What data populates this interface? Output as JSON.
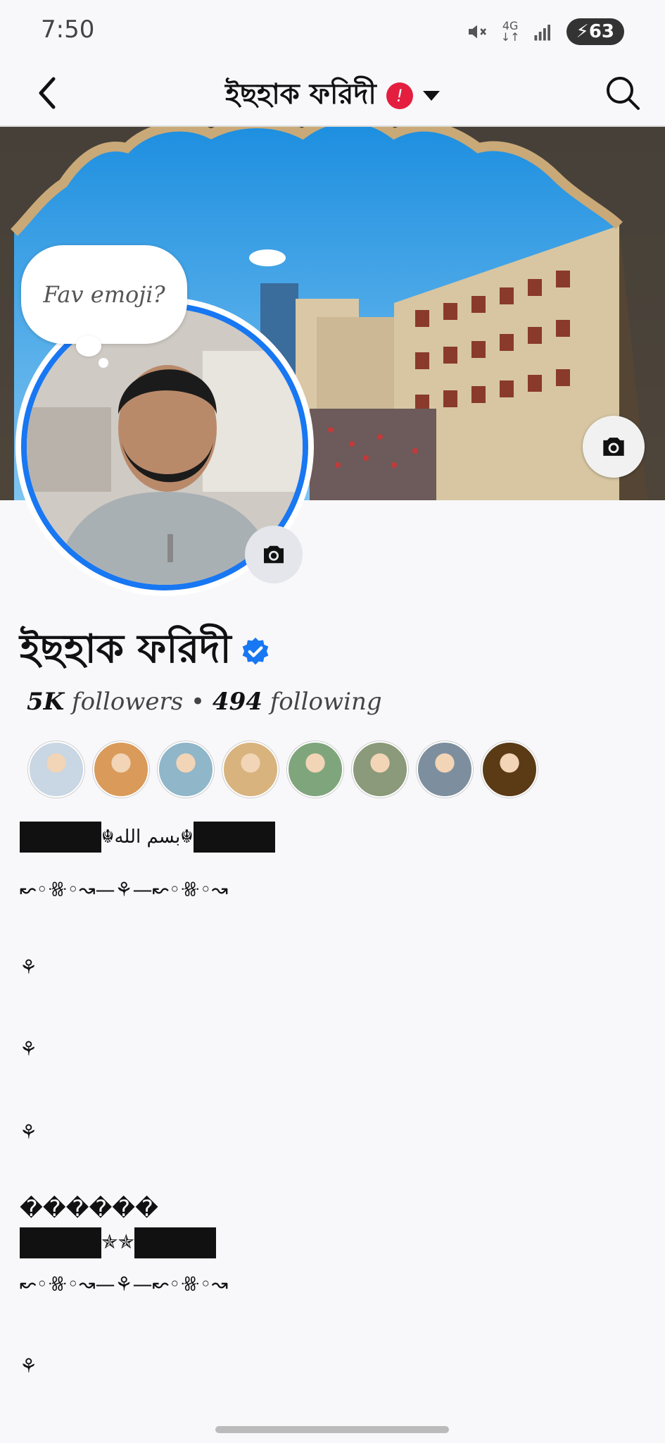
{
  "status_bar": {
    "time": "7:50",
    "network": "4G",
    "battery": "63"
  },
  "top_bar": {
    "title": "ইছহাক ফরিদী",
    "badge": "!"
  },
  "cover": {
    "bubble_text": "Fav emoji?"
  },
  "profile": {
    "name": "ইছহাক ফরিদী",
    "followers_count": "5K",
    "followers_label": "followers",
    "separator": "•",
    "following_count": "494",
    "following_label": "following"
  },
  "friends": [
    {
      "color": "#c9d6e3"
    },
    {
      "color": "#d99a5a"
    },
    {
      "color": "#8fb6c9"
    },
    {
      "color": "#d8b37e"
    },
    {
      "color": "#7fa57c"
    },
    {
      "color": "#8a9a7a"
    },
    {
      "color": "#7d8f9e"
    },
    {
      "color": "#5a3b16"
    }
  ],
  "bio": {
    "line1_center": "☬بسم الله☬",
    "line2": "↜◦ꗥ◦↝—⚘—↜◦ꗥ◦↝",
    "line3": "⚘",
    "line4": "⚘",
    "line5": "⚘",
    "line6": "������",
    "line7_center": "✯✯",
    "line8": "↜◦ꗥ◦↝—⚘—↜◦ꗥ◦↝",
    "line9": "⚘"
  },
  "colors": {
    "accent": "#1877f2",
    "badge": "#e41e3f"
  }
}
